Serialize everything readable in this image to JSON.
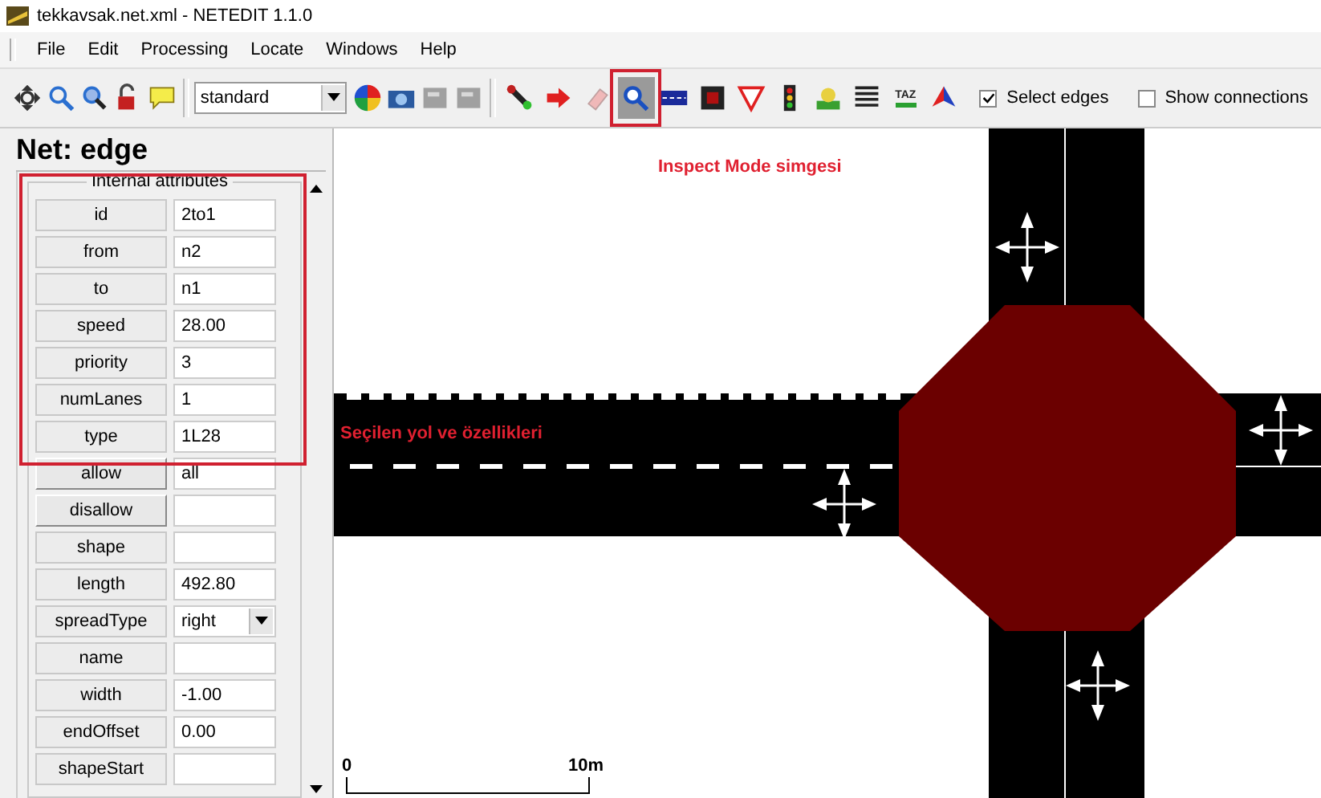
{
  "window": {
    "title": "tekkavsak.net.xml - NETEDIT 1.1.0"
  },
  "menu": [
    "File",
    "Edit",
    "Processing",
    "Locate",
    "Windows",
    "Help"
  ],
  "toolbar": {
    "view_tools": [
      {
        "kind": "move"
      },
      {
        "kind": "zoom"
      },
      {
        "kind": "locate"
      },
      {
        "kind": "lock"
      },
      {
        "kind": "bubble"
      }
    ],
    "scheme": "standard",
    "file_tools": [
      {
        "kind": "colorwheel"
      },
      {
        "kind": "camera"
      },
      {
        "kind": "grey"
      },
      {
        "kind": "grey"
      }
    ],
    "modes": [
      {
        "kind": "create",
        "selected": false
      },
      {
        "kind": "move-arrow",
        "selected": false
      },
      {
        "kind": "eraser",
        "selected": false
      },
      {
        "kind": "inspect",
        "selected": true
      },
      {
        "kind": "road",
        "selected": false
      },
      {
        "kind": "block",
        "selected": false
      },
      {
        "kind": "triangle",
        "selected": false
      },
      {
        "kind": "light",
        "selected": false
      },
      {
        "kind": "person",
        "selected": false
      },
      {
        "kind": "lines",
        "selected": false
      },
      {
        "kind": "taz",
        "label": "TAZ",
        "selected": false
      },
      {
        "kind": "prism",
        "selected": false
      }
    ],
    "checks": [
      {
        "label": "Select edges",
        "checked": true
      },
      {
        "label": "Show connections",
        "checked": false
      }
    ]
  },
  "panel": {
    "title": "Net: edge",
    "group": "Internal attributes",
    "attributes": [
      {
        "name": "id",
        "value": "2to1",
        "kind": "plain"
      },
      {
        "name": "from",
        "value": "n2",
        "kind": "plain"
      },
      {
        "name": "to",
        "value": "n1",
        "kind": "plain"
      },
      {
        "name": "speed",
        "value": "28.00",
        "kind": "plain"
      },
      {
        "name": "priority",
        "value": "3",
        "kind": "plain"
      },
      {
        "name": "numLanes",
        "value": "1",
        "kind": "plain"
      },
      {
        "name": "type",
        "value": "1L28",
        "kind": "plain"
      },
      {
        "name": "allow",
        "value": "all",
        "kind": "button"
      },
      {
        "name": "disallow",
        "kind": "button"
      },
      {
        "name": "shape",
        "kind": "plain"
      },
      {
        "name": "length",
        "value": "492.80",
        "kind": "plain"
      },
      {
        "name": "spreadType",
        "value": "right",
        "kind": "dropdown"
      },
      {
        "name": "name",
        "kind": "plain"
      },
      {
        "name": "width",
        "value": "-1.00",
        "kind": "plain"
      },
      {
        "name": "endOffset",
        "value": "0.00",
        "kind": "plain"
      },
      {
        "name": "shapeStart",
        "kind": "plain"
      }
    ]
  },
  "canvas": {
    "annotations": [
      {
        "text": "Inspect Mode simgesi"
      },
      {
        "text": "Seçilen yol ve özellikleri"
      }
    ],
    "scale": {
      "start": "0",
      "end": "10m"
    }
  }
}
